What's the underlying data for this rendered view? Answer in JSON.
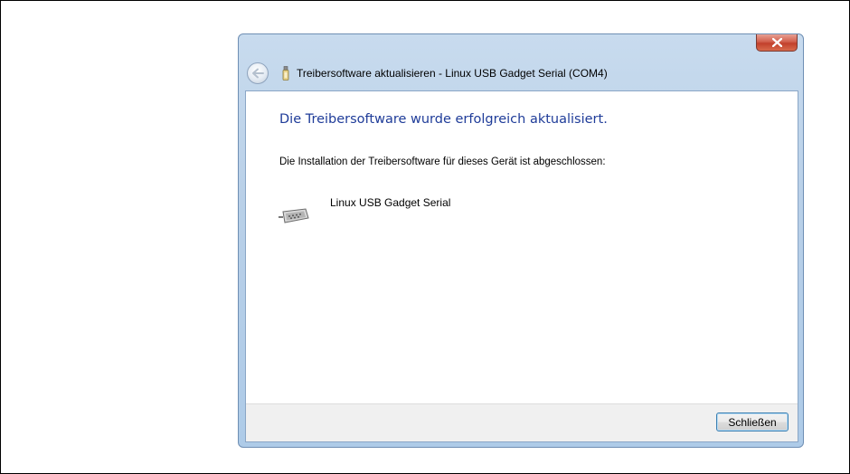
{
  "window": {
    "title": "Treibersoftware aktualisieren - Linux USB Gadget Serial (COM4)",
    "close_icon": "close-icon",
    "back_icon": "back-arrow-icon",
    "title_icon": "usb-device-icon"
  },
  "content": {
    "heading": "Die Treibersoftware wurde erfolgreich aktualisiert.",
    "description": "Die Installation der Treibersoftware für dieses Gerät ist abgeschlossen:",
    "device": {
      "name": "Linux USB Gadget Serial",
      "icon": "serial-port-icon"
    }
  },
  "footer": {
    "close_label": "Schließen"
  },
  "colors": {
    "heading": "#1f3c99",
    "close_button": "#c2402c",
    "window_frame": "#b9d0e8"
  }
}
